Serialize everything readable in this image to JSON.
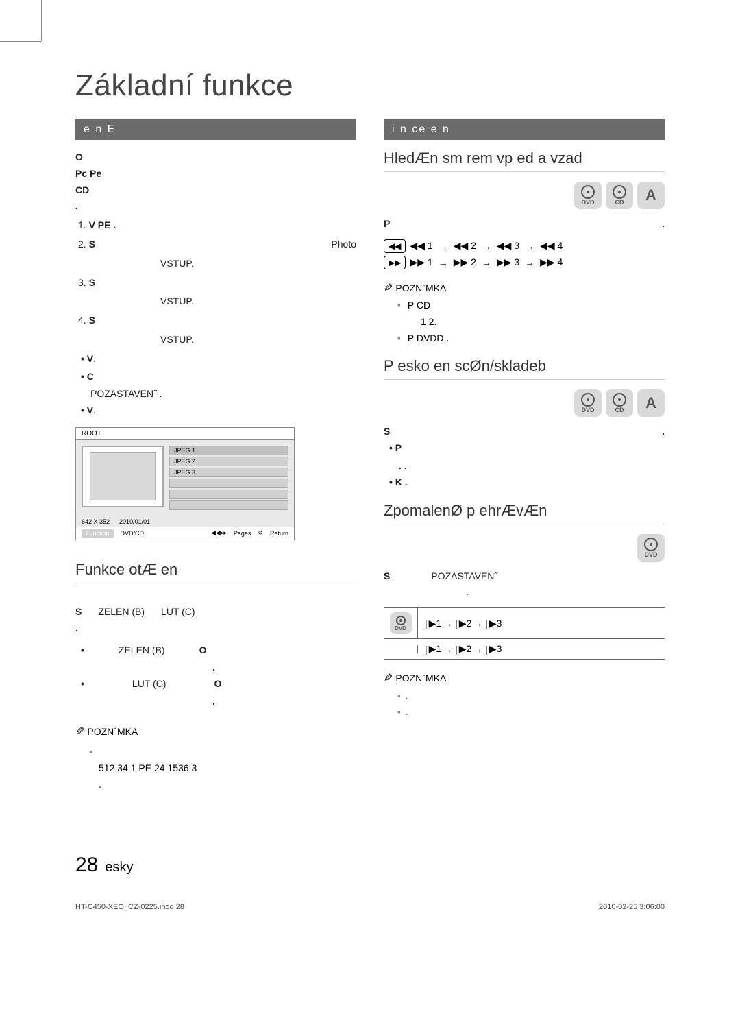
{
  "title": "Základní funkce",
  "left": {
    "bar": "e n   E",
    "intro_bold": "O",
    "intro_lines": [
      "Pc Pe",
      "CD",
      "."
    ],
    "steps": [
      {
        "n": "1.",
        "bold": "V  PE .",
        "rest": ""
      },
      {
        "n": "2.",
        "bold": "S",
        "rest": "Photo",
        "after": "VSTUP."
      },
      {
        "n": "3.",
        "bold": "S",
        "rest": "",
        "after": "VSTUP."
      },
      {
        "n": "4.",
        "bold": "S",
        "rest": "",
        "after": "VSTUP."
      }
    ],
    "bullets": [
      {
        "bold": "V",
        "rest": "."
      },
      {
        "bold": "C",
        "rest": "",
        "after": "POZASTAVEN˝ ."
      },
      {
        "bold": "V",
        "rest": "."
      }
    ],
    "screenshot": {
      "root": "ROOT",
      "items": [
        "JPEG 1",
        "JPEG 2",
        "JPEG 3"
      ],
      "meta_res": "642 X 352",
      "meta_date": "2010/01/01",
      "footer_btn": "Function",
      "footer_label": "DVD/CD",
      "footer_pages": "Pages",
      "footer_return": "Return"
    },
    "subheading": "Funkce otÆ en",
    "rotate_text": {
      "s": "S",
      "green": "ZELEN  (B)",
      "yellow": "LUT  (C)",
      "dot": "."
    },
    "rotate_bullets": [
      {
        "a": "ZELEN  (B)",
        "b": "O",
        "c": "."
      },
      {
        "a": "LUT  (C)",
        "b": "O",
        "c": "."
      }
    ],
    "note_label": "POZN`MKA",
    "note_body_bold": "512  34  1 PE  24  1536 3",
    "note_body_end": "."
  },
  "right": {
    "bar": "i  n ce e n",
    "sub1": "HledÆn  sm rem vp ed a vzad",
    "p_line": {
      "bold": "P",
      "rest": "."
    },
    "rewind_btn": "◀◀",
    "forward_btn": "▶▶",
    "seq_rew": [
      "◀◀ 1",
      "◀◀ 2",
      "◀◀ 3",
      "◀◀ 4"
    ],
    "seq_fwd": [
      "▶▶ 1",
      "▶▶ 2",
      "▶▶ 3",
      "▶▶ 4"
    ],
    "note_label": "POZN`MKA",
    "note1_lines": [
      {
        "bold": "P  CD",
        "rest": " 1  2."
      },
      {
        "bold": "P  DVDD .",
        "rest": ""
      }
    ],
    "sub2": "P esko en  scØn/skladeb",
    "skip_s": {
      "bold": "S",
      "rest": "."
    },
    "skip_bullets": [
      {
        "bold": "P",
        "rest": ". ."
      },
      {
        "bold": "K .",
        "rest": ""
      }
    ],
    "sub3": "ZpomalenØ p ehrÆvÆn",
    "slow_s": {
      "bold": "S",
      "mid": "POZASTAVEN˝",
      "rest": "."
    },
    "slow_seq": [
      "▶1",
      "▶2",
      "▶3"
    ],
    "note2_dots": [
      ".",
      "."
    ]
  },
  "footer": {
    "page": "28",
    "lang": "esky"
  },
  "print": {
    "file": "HT-C450-XEO_CZ-0225.indd   28",
    "stamp": "2010-02-25     3:06:00"
  }
}
